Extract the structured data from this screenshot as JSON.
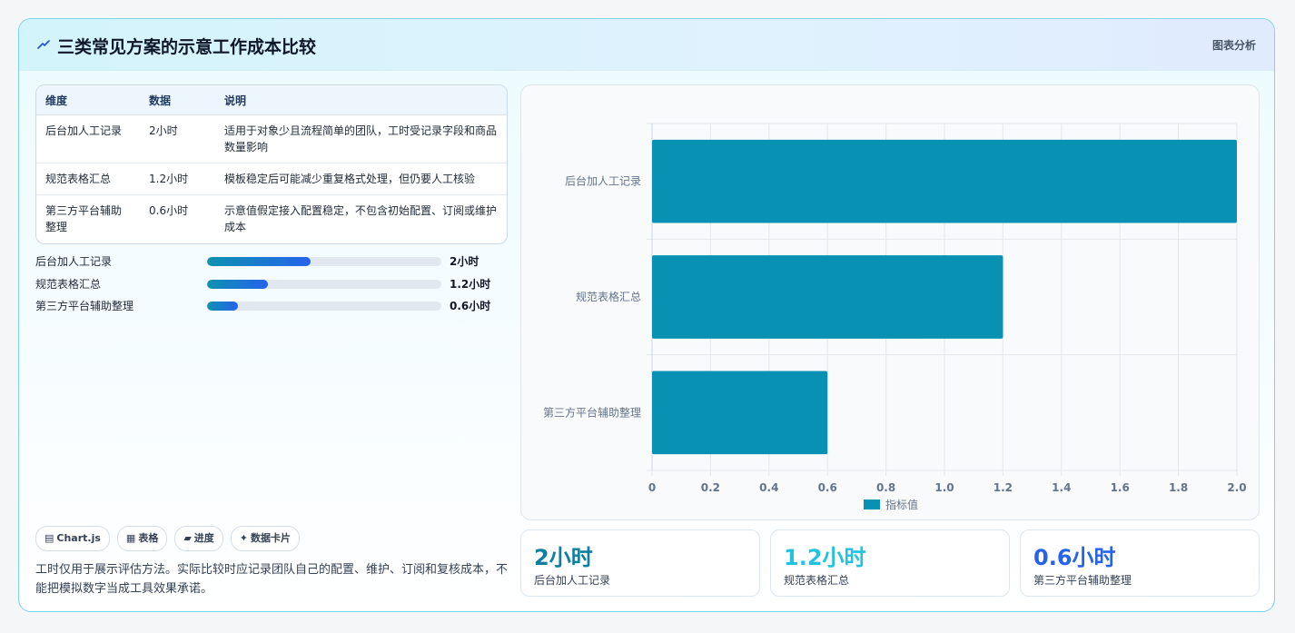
{
  "header": {
    "title": "三类常见方案的示意工作成本比较",
    "tag": "图表分析"
  },
  "table": {
    "headers": [
      "维度",
      "数据",
      "说明"
    ],
    "rows": [
      {
        "name": "后台加人工记录",
        "value": "2小时",
        "desc": "适用于对象少且流程简单的团队，工时受记录字段和商品数量影响"
      },
      {
        "name": "规范表格汇总",
        "value": "1.2小时",
        "desc": "模板稳定后可能减少重复格式处理，但仍要人工核验"
      },
      {
        "name": "第三方平台辅助整理",
        "value": "0.6小时",
        "desc": "示意值假定接入配置稳定，不包含初始配置、订阅或维护成本"
      }
    ]
  },
  "progress": [
    {
      "label": "后台加人工记录",
      "value": "2小时",
      "fraction": 0.44
    },
    {
      "label": "规范表格汇总",
      "value": "1.2小时",
      "fraction": 0.26
    },
    {
      "label": "第三方平台辅助整理",
      "value": "0.6小时",
      "fraction": 0.13
    }
  ],
  "chips": [
    {
      "icon": "▤",
      "label": "Chart.js"
    },
    {
      "icon": "▦",
      "label": "表格"
    },
    {
      "icon": "▰",
      "label": "进度"
    },
    {
      "icon": "✦",
      "label": "数据卡片"
    }
  ],
  "note": "工时仅用于展示评估方法。实际比较时应记录团队自己的配置、维护、订阅和复核成本，不能把模拟数字当成工具效果承诺。",
  "stats": [
    {
      "value": "2小时",
      "label": "后台加人工记录",
      "color": "#0e7f9e"
    },
    {
      "value": "1.2小时",
      "label": "规范表格汇总",
      "color": "#22c3e0"
    },
    {
      "value": "0.6小时",
      "label": "第三方平台辅助整理",
      "color": "#2563eb"
    }
  ],
  "chart_data": {
    "type": "bar",
    "orientation": "horizontal",
    "categories": [
      "后台加人工记录",
      "规范表格汇总",
      "第三方平台辅助整理"
    ],
    "series": [
      {
        "name": "指标值",
        "values": [
          2,
          1.2,
          0.6
        ],
        "color": "#0891b2"
      }
    ],
    "xlim": [
      0,
      2
    ],
    "xticks": [
      "0",
      "0.2",
      "0.4",
      "0.6",
      "0.8",
      "1.0",
      "1.2",
      "1.4",
      "1.6",
      "1.8",
      "2.0"
    ],
    "grid": true,
    "legend": "bottom"
  }
}
